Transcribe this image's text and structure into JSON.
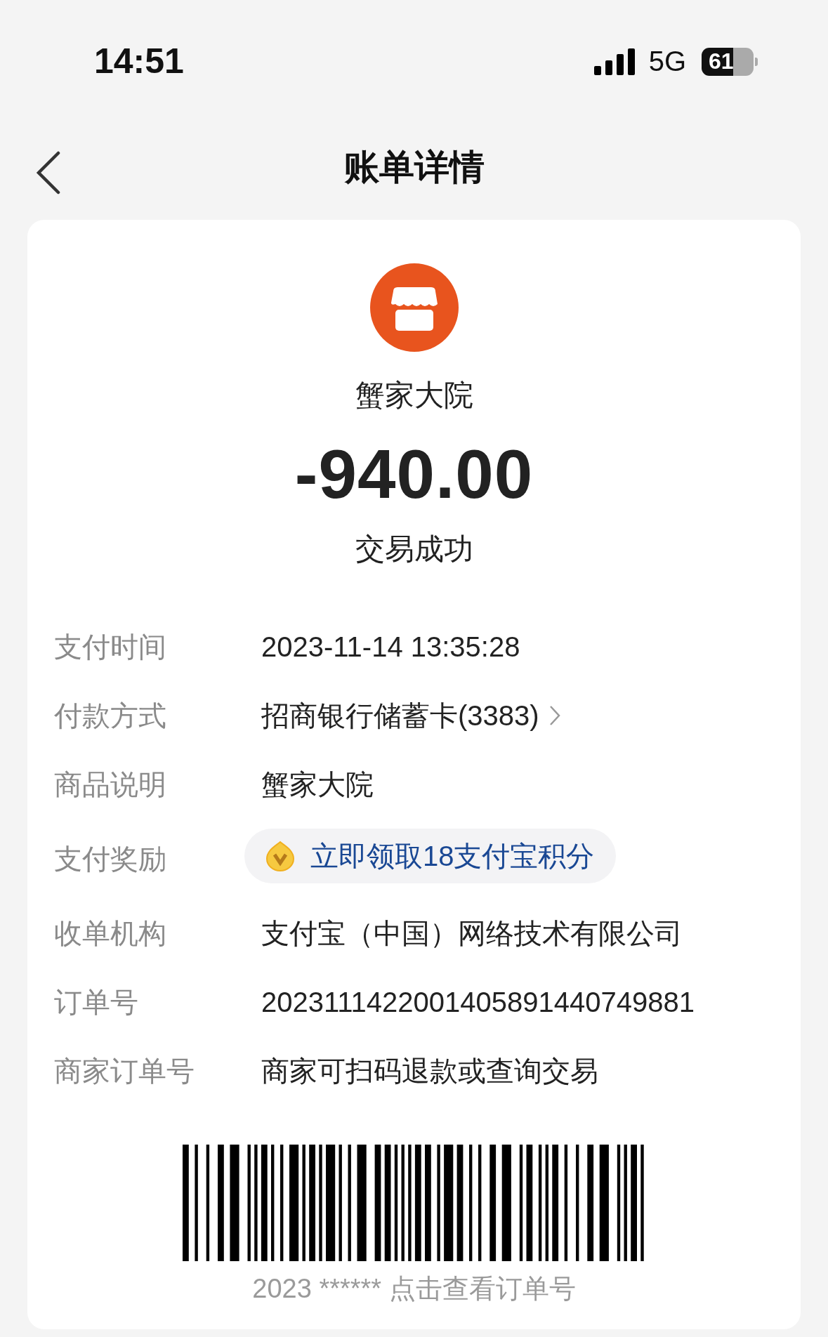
{
  "status_bar": {
    "time": "14:51",
    "network": "5G",
    "battery": "61"
  },
  "nav": {
    "title": "账单详情"
  },
  "merchant": {
    "name": "蟹家大院",
    "amount": "-940.00",
    "status": "交易成功"
  },
  "details": [
    {
      "kind": "text",
      "label": "支付时间",
      "value": "2023-11-14 13:35:28"
    },
    {
      "kind": "link",
      "label": "付款方式",
      "value": "招商银行储蓄卡(3383)"
    },
    {
      "kind": "text",
      "label": "商品说明",
      "value": "蟹家大院"
    },
    {
      "kind": "reward",
      "label": "支付奖励",
      "value": "立即领取18支付宝积分"
    },
    {
      "kind": "text",
      "label": "收单机构",
      "value": "支付宝（中国）网络技术有限公司"
    },
    {
      "kind": "text",
      "label": "订单号",
      "value": "2023111422001405891440749881"
    },
    {
      "kind": "text",
      "label": "商家订单号",
      "value": "商家可扫码退款或查询交易"
    }
  ],
  "barcode": {
    "caption": "2023 ****** 点击查看订单号"
  }
}
